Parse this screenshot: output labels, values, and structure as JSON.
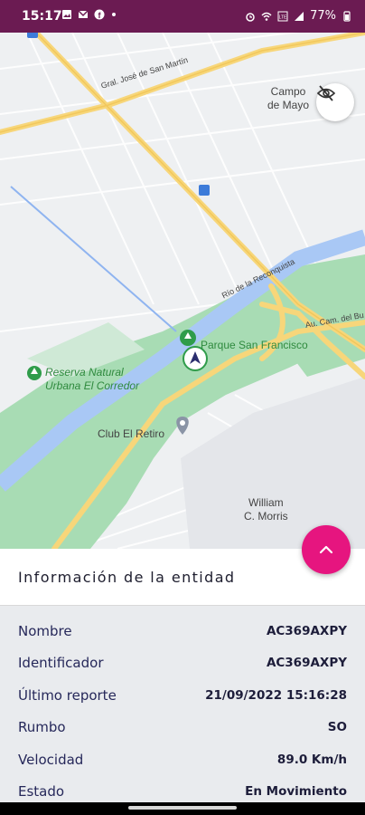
{
  "status_bar": {
    "time": "15:17",
    "battery": "77%",
    "left_icons": [
      "image-icon",
      "gmail-icon",
      "facebook-icon",
      "dot-icon"
    ],
    "right_icons": [
      "alarm-icon",
      "wifi-icon",
      "volte-icon",
      "signal-icon",
      "battery-icon"
    ]
  },
  "map": {
    "labels": {
      "campo_de_mayo_1": "Campo",
      "campo_de_mayo_2": "de Mayo",
      "parque": "Parque San Francisco",
      "reserva_1": "Reserva Natural",
      "reserva_2": "Urbana El Corredor",
      "club": "Club El Retiro",
      "william_1": "William",
      "william_2": "C. Morris",
      "road_san_martin": "Gral. José de San Martín",
      "road_reconquista": "Río de la Reconquista",
      "road_au": "Au. Cam. del Bu"
    }
  },
  "panel": {
    "title": "Información de la entidad",
    "rows": [
      {
        "label": "Nombre",
        "value": "AC369AXPY"
      },
      {
        "label": "Identificador",
        "value": "AC369AXPY"
      },
      {
        "label": "Último reporte",
        "value": "21/09/2022 15:16:28"
      },
      {
        "label": "Rumbo",
        "value": "SO"
      },
      {
        "label": "Velocidad",
        "value": "89.0 Km/h"
      },
      {
        "label": "Estado",
        "value": "En Movimiento"
      }
    ]
  },
  "colors": {
    "status_bar": "#6b1b52",
    "fab": "#e6157f",
    "park": "#a8dcb4",
    "river": "#a9c8f5",
    "road": "#f7d67a"
  }
}
